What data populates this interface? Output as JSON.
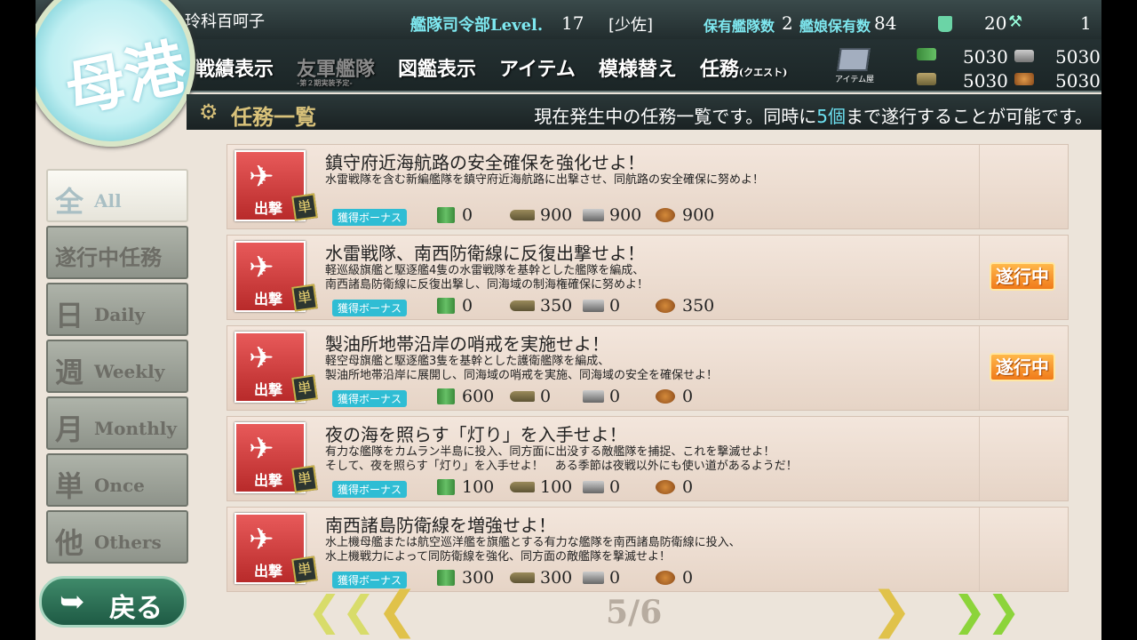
{
  "header": {
    "admiral_name": "玲科百呵子",
    "level_label": "艦隊司令部Level.",
    "level": "17",
    "rank": "[少佐]",
    "fleets_label": "保有艦隊数",
    "fleets": "2",
    "ships_label": "艦娘保有数",
    "ships": "84",
    "buckets": "20",
    "screws": "1",
    "emblem_char": "母港"
  },
  "nav": {
    "items": [
      "戦績表示",
      "友軍艦隊",
      "図鑑表示",
      "アイテム",
      "模様替え",
      "任務"
    ],
    "friend_fleet_sub": "-第２期実装予定-",
    "quest_suffix": "(クエスト)",
    "item_shop_label": "アイテム屋"
  },
  "resources": {
    "fuel": "5030",
    "ammo": "5030",
    "steel": "5030",
    "bauxite": "5030"
  },
  "section": {
    "title": "任務一覧",
    "note_pre": "現在発生中の任務一覧です。同時に",
    "note_hl": "5個",
    "note_post": "まで遂行することが可能です。"
  },
  "tabs": [
    {
      "kanji": "全",
      "label": "All",
      "active": true
    },
    {
      "full": "遂行中任務",
      "active": false
    },
    {
      "kanji": "日",
      "label": "Daily",
      "active": false
    },
    {
      "kanji": "週",
      "label": "Weekly",
      "active": false
    },
    {
      "kanji": "月",
      "label": "Monthly",
      "active": false
    },
    {
      "kanji": "単",
      "label": "Once",
      "active": false
    },
    {
      "kanji": "他",
      "label": "Others",
      "active": false
    }
  ],
  "back_label": "戻る",
  "quest_common": {
    "category": "出撃",
    "type_badge": "単",
    "bonus_label": "獲得ボーナス",
    "in_progress_label": "遂行中"
  },
  "quests": [
    {
      "title": "鎮守府近海航路の安全確保を強化せよ！",
      "desc": "水雷戦隊を含む新編艦隊を鎮守府近海航路に出撃させ、同航路の安全確保に努めよ！",
      "fuel": "0",
      "ammo": "900",
      "steel": "900",
      "bauxite": "900",
      "in_progress": false
    },
    {
      "title": "水雷戦隊、南西防衛線に反復出撃せよ！",
      "desc": "軽巡級旗艦と駆逐艦4隻の水雷戦隊を基幹とした艦隊を編成、\n南西諸島防衛線に反復出撃し、同海域の制海権確保に努めよ！",
      "fuel": "0",
      "ammo": "350",
      "steel": "0",
      "bauxite": "350",
      "in_progress": true
    },
    {
      "title": "製油所地帯沿岸の哨戒を実施せよ！",
      "desc": "軽空母旗艦と駆逐艦3隻を基幹とした護衛艦隊を編成、\n製油所地帯沿岸に展開し、同海域の哨戒を実施、同海域の安全を確保せよ！",
      "fuel": "600",
      "ammo": "0",
      "steel": "0",
      "bauxite": "0",
      "in_progress": true
    },
    {
      "title": "夜の海を照らす「灯り」を入手せよ！",
      "desc": "有力な艦隊をカムラン半島に投入、同方面に出没する敵艦隊を捕捉、これを撃滅せよ！\nそして、夜を照らす「灯り」を入手せよ！　ある季節は夜戦以外にも使い道があるようだ！",
      "fuel": "100",
      "ammo": "100",
      "steel": "0",
      "bauxite": "0",
      "in_progress": false
    },
    {
      "title": "南西諸島防衛線を増強せよ！",
      "desc": "水上機母艦または航空巡洋艦を旗艦とする有力な艦隊を南西諸島防衛線に投入、\n水上機戦力によって同防衛線を強化、同方面の敵艦隊を撃滅せよ！",
      "fuel": "300",
      "ammo": "300",
      "steel": "0",
      "bauxite": "0",
      "in_progress": false
    }
  ],
  "pager": {
    "current": "5",
    "total": "6",
    "display": "5/6"
  }
}
